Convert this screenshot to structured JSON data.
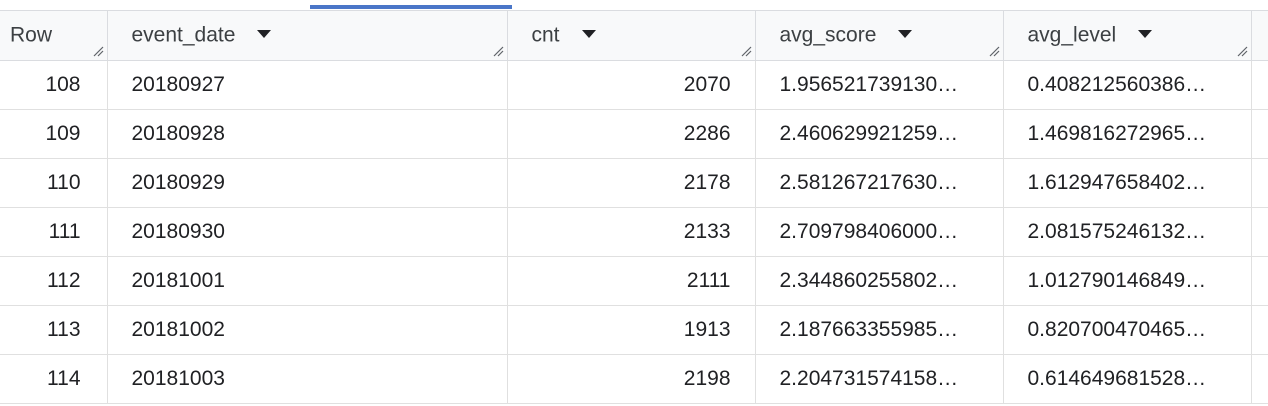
{
  "table": {
    "columns": [
      {
        "key": "row",
        "label": "Row",
        "sortable": false
      },
      {
        "key": "event_date",
        "label": "event_date",
        "sortable": true
      },
      {
        "key": "cnt",
        "label": "cnt",
        "sortable": true
      },
      {
        "key": "avg_score",
        "label": "avg_score",
        "sortable": true
      },
      {
        "key": "avg_level",
        "label": "avg_level",
        "sortable": true
      }
    ],
    "rows": [
      {
        "row": "108",
        "event_date": "20180927",
        "cnt": "2070",
        "avg_score": "1.956521739130…",
        "avg_level": "0.408212560386…"
      },
      {
        "row": "109",
        "event_date": "20180928",
        "cnt": "2286",
        "avg_score": "2.460629921259…",
        "avg_level": "1.469816272965…"
      },
      {
        "row": "110",
        "event_date": "20180929",
        "cnt": "2178",
        "avg_score": "2.581267217630…",
        "avg_level": "1.612947658402…"
      },
      {
        "row": "111",
        "event_date": "20180930",
        "cnt": "2133",
        "avg_score": "2.709798406000…",
        "avg_level": "2.081575246132…"
      },
      {
        "row": "112",
        "event_date": "20181001",
        "cnt": "2111",
        "avg_score": "2.344860255802…",
        "avg_level": "1.012790146849…"
      },
      {
        "row": "113",
        "event_date": "20181002",
        "cnt": "1913",
        "avg_score": "2.187663355985…",
        "avg_level": "0.820700470465…"
      },
      {
        "row": "114",
        "event_date": "20181003",
        "cnt": "2198",
        "avg_score": "2.204731574158…",
        "avg_level": "0.614649681528…"
      }
    ]
  },
  "colors": {
    "header_bg": "#f8f9fa",
    "border": "#dadce0",
    "active_tab_indicator": "#4a76c8"
  },
  "icons": {
    "sort": "caret-down-icon",
    "resize": "resize-handle-icon"
  }
}
